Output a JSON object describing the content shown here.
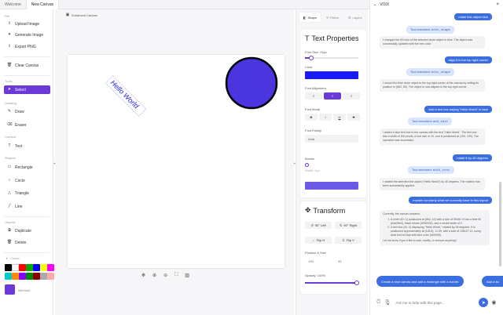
{
  "tabs": [
    "Welcome",
    "New Canvas"
  ],
  "sidebar": {
    "file_label": "File",
    "file_items": [
      "Upload Image",
      "Generate Image",
      "Export PNG"
    ],
    "clear_label": "Clear Canvas",
    "tools_label": "Tools",
    "select_label": "Select",
    "drawing_label": "Drawing",
    "drawing_items": [
      "Draw",
      "Eraser"
    ],
    "content_label": "Content",
    "text_label": "Text",
    "shapes_label": "Shapes",
    "shape_items": [
      "Rectangle",
      "Circle",
      "Triangle",
      "Line"
    ],
    "objects_label": "Objects",
    "object_items": [
      "Duplicate",
      "Delete"
    ],
    "colors_label": "Colors",
    "swatches": [
      "#000000",
      "#ffffff",
      "#ff0000",
      "#00aa00",
      "#0000ff",
      "#ffff00",
      "#ff00ff",
      "#00cccc",
      "#ff8800",
      "#8800ff",
      "#008800",
      "#880000",
      "#aaaaaa",
      "#ffaaaa"
    ],
    "custom_color": "#6b3ad6",
    "custom_label": "#6b3ad6"
  },
  "canvas": {
    "label": "Enhanced Canvas",
    "text_object": "Hello World",
    "text_color": "#1a1aff",
    "circle_fill": "#4a35e0",
    "circle_stroke": "#000000"
  },
  "rightpanel": {
    "tabs": [
      "Shape",
      "Filters",
      "Layers"
    ],
    "text_props_title": "Text Properties",
    "font_size_label": "Font Size: 24px",
    "font_size_fraction": 0.12,
    "color_label": "Color",
    "text_color": "#1a1aff",
    "alignment_label": "Font Alignment",
    "mode_label": "Font Mode",
    "mode_buttons": [
      "B",
      "I",
      "U",
      "S"
    ],
    "family_label": "Font Family",
    "family_value": "Arial",
    "border_label": "Border",
    "border_width_label": "Width: 0px",
    "border_color": "#6b5ae8",
    "transform_title": "Transform",
    "rotate_left": "90° Left",
    "rotate_right": "90° Right",
    "flip_h": "Flip H",
    "flip_v": "Flip V",
    "pos_size_label": "Position & Size",
    "pos_x": "139",
    "pos_y": "33",
    "opacity_label": "Opacity: 100%",
    "opacity_fraction": 1.0
  },
  "chat": {
    "title": "VOIX",
    "messages": [
      {
        "type": "user",
        "text": "make this object blue"
      },
      {
        "type": "tool",
        "label": "Tool executed: ",
        "fn": "edit_shape"
      },
      {
        "type": "ai",
        "text": "I changed the fill color of the selected circle object to blue. The object was successfully updated with the new color."
      },
      {
        "type": "user",
        "text": "align it in the top right corner"
      },
      {
        "type": "tool",
        "label": "Tool executed: ",
        "fn": "edit_shape"
      },
      {
        "type": "ai",
        "text": "I moved the blue circle object to the top-right corner of the canvas by setting its position to (562, 80). The object is now aligned in the top-right corner."
      },
      {
        "type": "user",
        "text": "Add a text box saying \"Hello World\" in blue"
      },
      {
        "type": "tool",
        "label": "Tool executed: ",
        "fn": "add_text"
      },
      {
        "type": "ai",
        "text": "I added a blue text box to the canvas with the text \"Hello World\". The text box has a width of 200 pixels, a font size of 24, and is positioned at (100, 100). The operation was successful."
      },
      {
        "type": "user",
        "text": "rotate it by 45 degrees"
      },
      {
        "type": "tool",
        "label": "Tool executed: ",
        "fn": "edit_text"
      },
      {
        "type": "ai",
        "text": "I rotated the selected text object (\"Hello World\") by 45 degrees. The rotation has been successfully applied."
      },
      {
        "type": "user",
        "text": "explain concisely what we currently have in this layout"
      }
    ],
    "final_intro": "Currently, the canvas contains:",
    "final_items": [
      "A circle (ID: 1) positioned at (562, 10) with a size of 50x50. It has a blue fill (#4a35e0), black stroke (#000000), and a stroke width of 2.",
      "A text box (ID: 2) displaying \"Hello World,\" rotated by 45 degrees. It is positioned approximately at (118.8), 11.59, with a size of 198x27.12, using Arial font at 24pt with blue color (#0000ff)."
    ],
    "final_outro": "Let me know if you'd like to add, modify, or remove anything!",
    "suggestions": [
      "Create a new canvas and add a rectangle with a border.",
      "Add a bo"
    ],
    "input_placeholder": "Ask me to help with this page..."
  }
}
